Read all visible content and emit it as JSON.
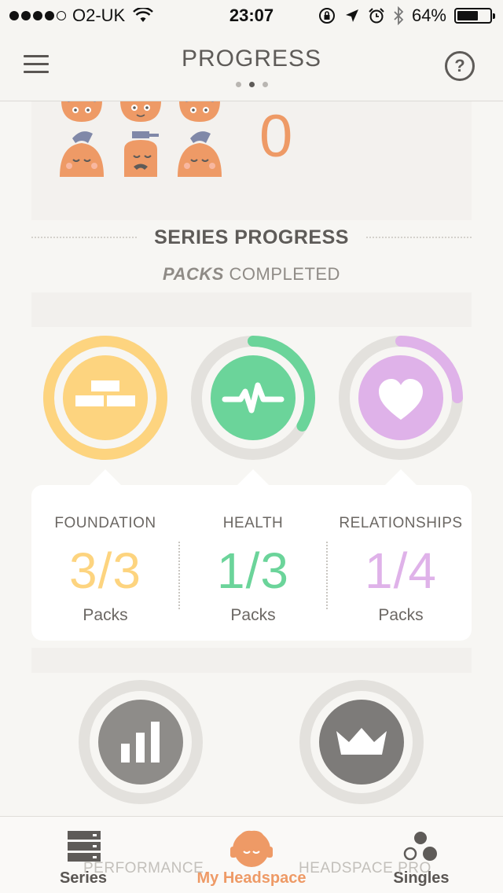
{
  "status_bar": {
    "carrier": "O2-UK",
    "time": "23:07",
    "battery": "64%",
    "battery_level": 0.64
  },
  "nav": {
    "title": "PROGRESS",
    "help": "?",
    "page_count": 3,
    "active_page": 2
  },
  "top_card": {
    "count": "0"
  },
  "series_progress": {
    "title": "SERIES PROGRESS",
    "subtitle_bold": "PACKS",
    "subtitle_rest": " COMPLETED"
  },
  "series": [
    {
      "name": "FOUNDATION",
      "value": "3/3",
      "unit": "Packs",
      "progress": 1.0,
      "color": "#fdd47f",
      "icon": "bricks-icon"
    },
    {
      "name": "HEALTH",
      "value": "1/3",
      "unit": "Packs",
      "progress": 0.333,
      "color": "#6bd49a",
      "icon": "heartbeat-icon"
    },
    {
      "name": "RELATIONSHIPS",
      "value": "1/4",
      "unit": "Packs",
      "progress": 0.25,
      "color": "#dfb2e9",
      "icon": "heart-icon"
    }
  ],
  "bottom_icons": [
    "bar-chart-icon",
    "crown-icon"
  ],
  "tabs": {
    "series": "Series",
    "my_headspace": "My Headspace",
    "singles": "Singles",
    "performance_ghost": "PERFORMANCE",
    "headspace_pro_ghost": "HEADSPACE PRO"
  },
  "colors": {
    "accent": "#ee9a66",
    "ring_track": "#e3e1dd",
    "muted_disc": "#8e8c89"
  }
}
